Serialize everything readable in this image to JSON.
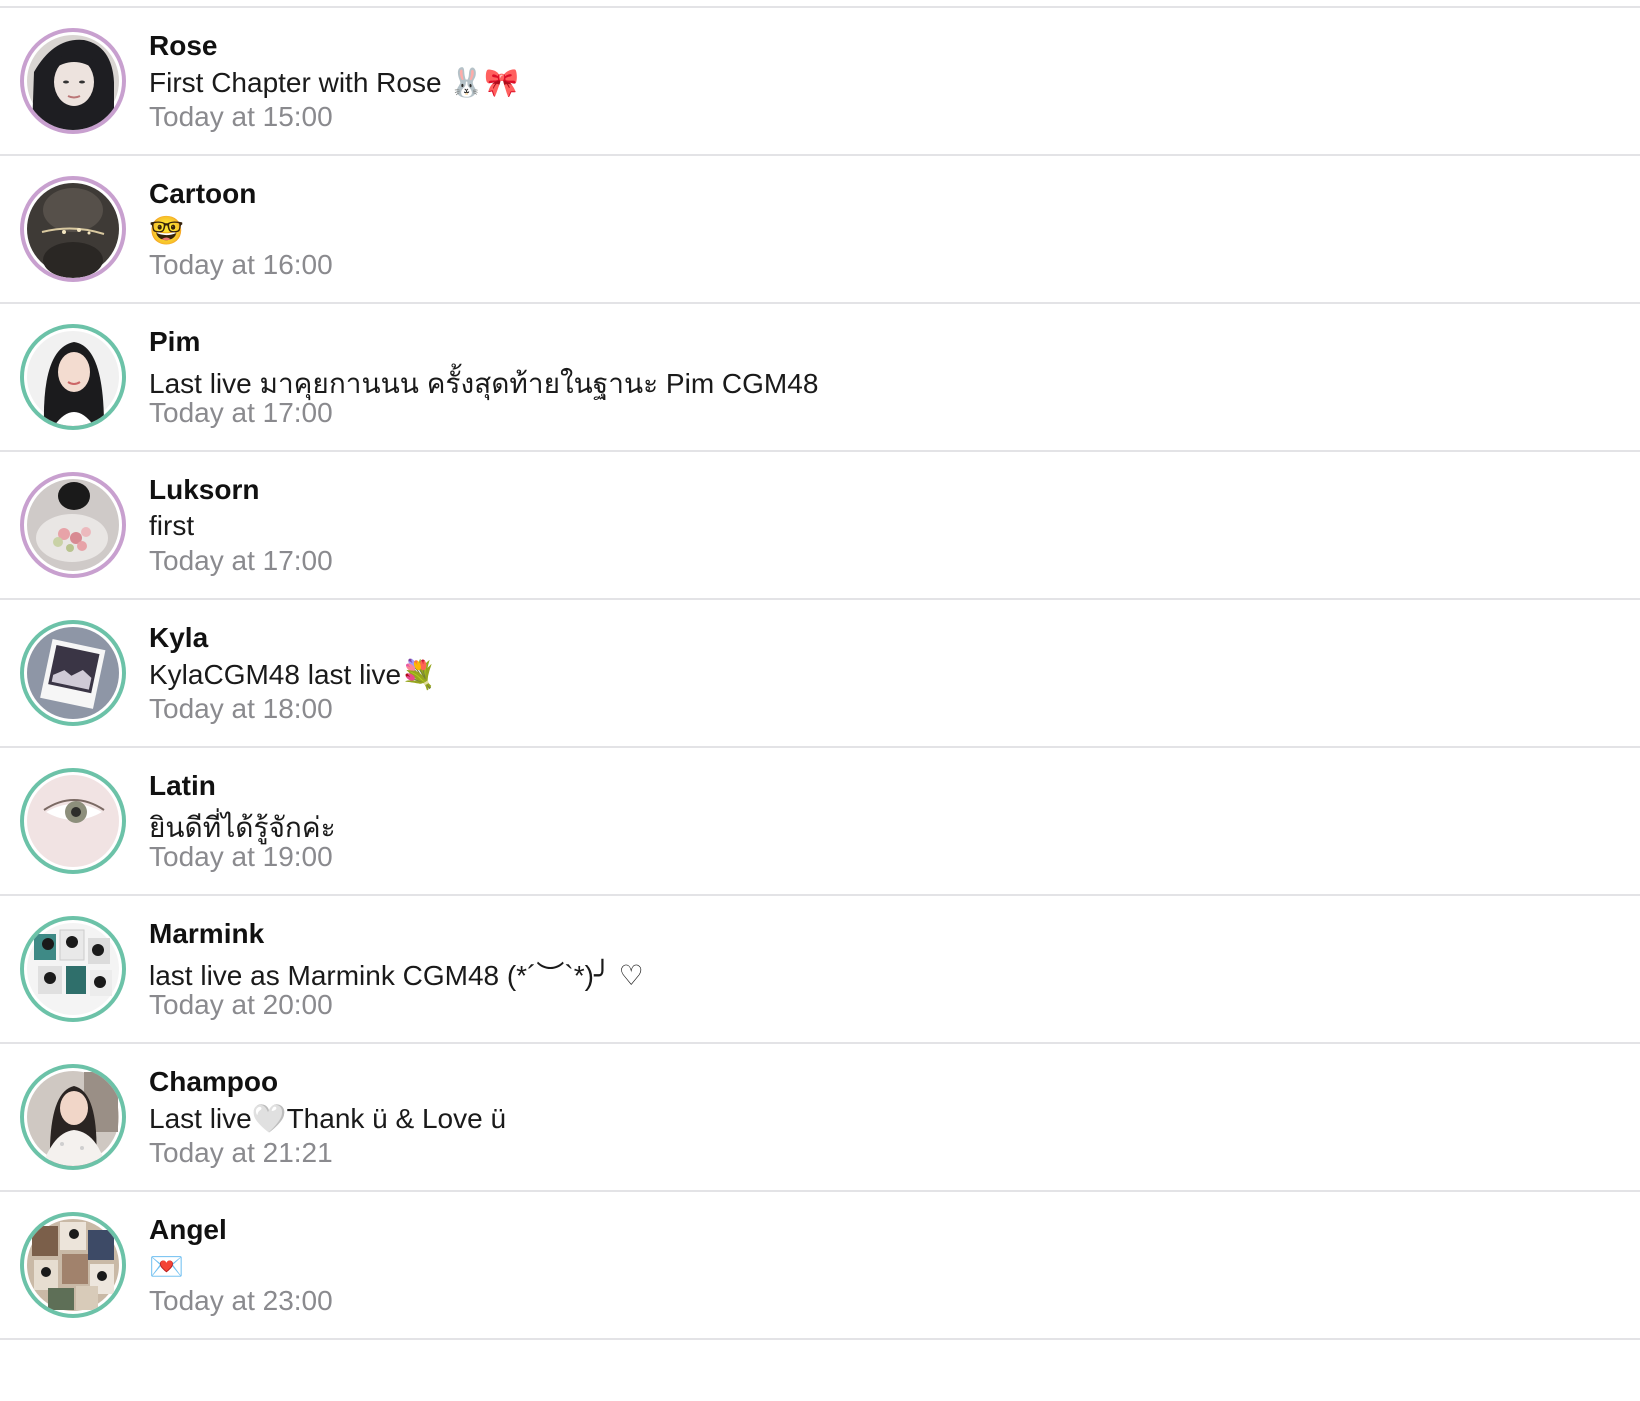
{
  "schedule": {
    "items": [
      {
        "name": "Rose",
        "message": "First Chapter with Rose 🐰🎀",
        "time": "Today at 15:00",
        "ring_color": "#c8a0cf"
      },
      {
        "name": "Cartoon",
        "message": "🤓",
        "time": "Today at 16:00",
        "ring_color": "#c8a0cf"
      },
      {
        "name": "Pim",
        "message": "Last live มาคุยกานนน ครั้งสุดท้ายในฐานะ Pim CGM48",
        "time": "Today at 17:00",
        "ring_color": "#6cc2a8"
      },
      {
        "name": "Luksorn",
        "message": "first",
        "time": "Today at 17:00",
        "ring_color": "#c8a0cf"
      },
      {
        "name": "Kyla",
        "message": "KylaCGM48 last live💐",
        "time": "Today at 18:00",
        "ring_color": "#6cc2a8"
      },
      {
        "name": "Latin",
        "message": "ยินดีที่ได้รู้จักค่ะ",
        "time": "Today at 19:00",
        "ring_color": "#6cc2a8"
      },
      {
        "name": "Marmink",
        "message": "last live as Marmink CGM48 (*´︶`*)╯ ♡",
        "time": "Today at 20:00",
        "ring_color": "#6cc2a8"
      },
      {
        "name": "Champoo",
        "message": "Last live🤍Thank ü & Love ü",
        "time": "Today at 21:21",
        "ring_color": "#6cc2a8"
      },
      {
        "name": "Angel",
        "message": "💌",
        "time": "Today at 23:00",
        "ring_color": "#6cc2a8"
      }
    ]
  },
  "colors": {
    "purple_ring": "#c8a0cf",
    "green_ring": "#6cc2a8",
    "divider": "#e3e3e6",
    "time_text": "#8a8a8e"
  }
}
